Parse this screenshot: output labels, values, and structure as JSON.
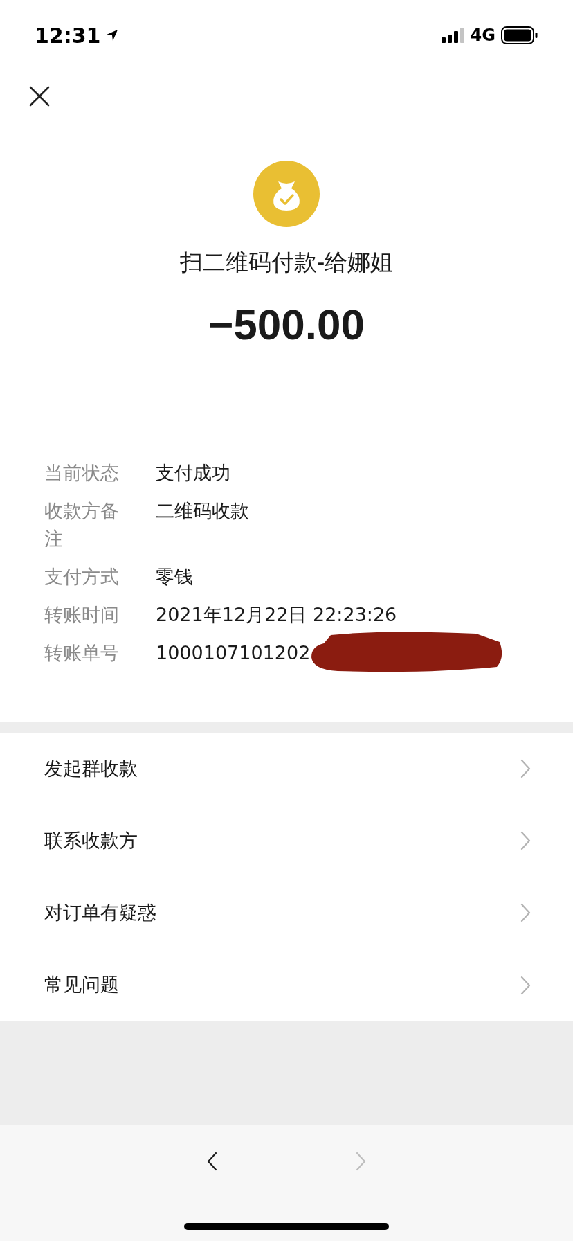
{
  "status_bar": {
    "time": "12:31",
    "network": "4G"
  },
  "title": "扫二维码付款-给娜姐",
  "amount": "−500.00",
  "details": [
    {
      "label": "当前状态",
      "value": "支付成功"
    },
    {
      "label": "收款方备注",
      "value": "二维码收款"
    },
    {
      "label": "支付方式",
      "value": "零钱"
    },
    {
      "label": "转账时间",
      "value": "2021年12月22日 22:23:26"
    },
    {
      "label": "转账单号",
      "value": "1000107101202"
    }
  ],
  "redaction_mark": true,
  "menu": [
    "发起群收款",
    "联系收款方",
    "对订单有疑惑",
    "常见问题"
  ],
  "nav": [
    {
      "kind": "back",
      "disabled": false
    },
    {
      "kind": "forward",
      "disabled": true
    }
  ]
}
